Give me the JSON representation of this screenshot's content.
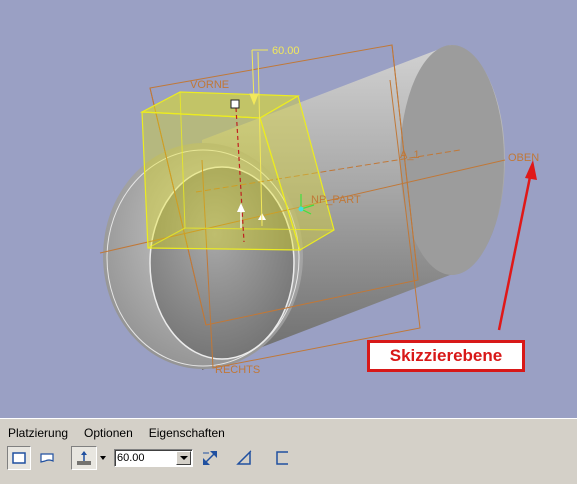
{
  "viewport": {
    "dimension_value": "60.00",
    "datum_labels": {
      "front": "VORNE",
      "axis": "A_1",
      "top": "OBEN",
      "right": "RECHTS",
      "csys": "NP_PART"
    },
    "annotation": "Skizzierebene",
    "colors": {
      "background": "#9aa0c4",
      "datum": "#c07838",
      "feature_preview": "#e8e600",
      "annotation": "#d81818"
    }
  },
  "dashboard": {
    "tabs": [
      "Platzierung",
      "Optionen",
      "Eigenschaften"
    ],
    "value": "60.00",
    "icons": [
      "solid-feature-icon",
      "surface-feature-icon",
      "depth-option-icon",
      "flip-direction-icon",
      "remove-material-icon",
      "thicken-sketch-icon"
    ]
  }
}
